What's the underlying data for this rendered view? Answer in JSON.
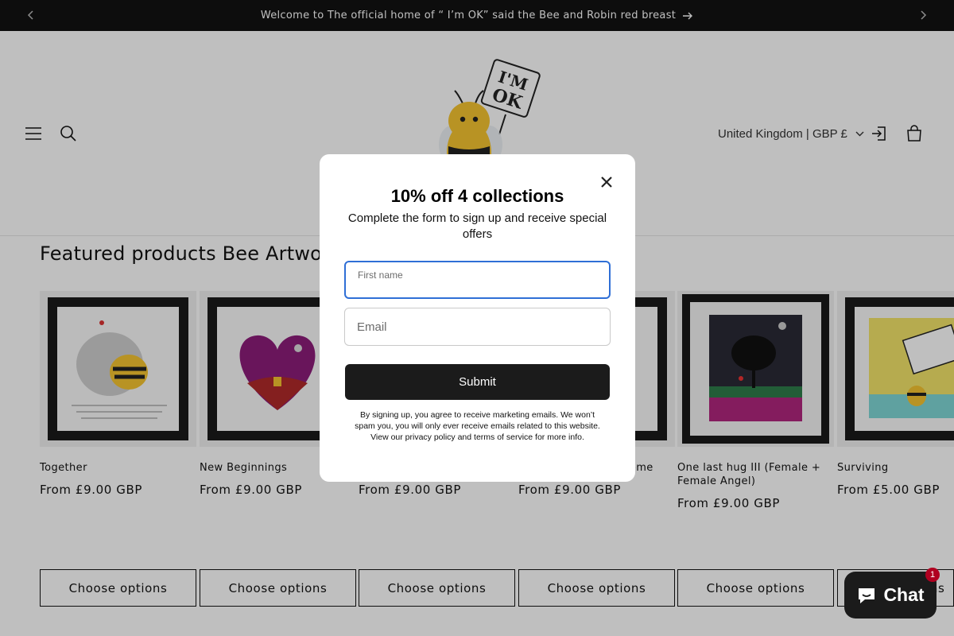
{
  "announcement": {
    "text": "Welcome to The official home of “ I’m OK” said the Bee and Robin red breast"
  },
  "header": {
    "logo_text": "I'M OK",
    "locale": "United Kingdom | GBP £"
  },
  "featured": {
    "title": "Featured products Bee Artworks",
    "button_label": "Choose options",
    "products": [
      {
        "title": "Together",
        "price": "From £9.00 GBP",
        "art": "together"
      },
      {
        "title": "New Beginnings",
        "price": "From £9.00 GBP",
        "art": "heart"
      },
      {
        "title": "",
        "price": "From £9.00 GBP",
        "art": "hidden"
      },
      {
        "title": "For how far you've come",
        "price": "From £9.00 GBP",
        "art": "hidden"
      },
      {
        "title": "One last hug III (Female + Female Angel)",
        "price": "From £9.00 GBP",
        "art": "tree"
      },
      {
        "title": "Surviving",
        "price": "From £5.00 GBP",
        "art": "surviving"
      }
    ]
  },
  "popup": {
    "title": "10% off 4 collections",
    "subtitle": "Complete the form to sign up and receive special offers",
    "first_name_label": "First name",
    "email_placeholder": "Email",
    "submit_label": "Submit",
    "legal": "By signing up, you agree to receive marketing emails. We won’t spam you, you will only ever receive emails related to this website. View our privacy policy and terms of service for more info."
  },
  "chat": {
    "label": "Chat",
    "badge": "1"
  },
  "colors": {
    "announcement_bg": "#121212",
    "focus_border": "#2f6fd6",
    "button_dark": "#1b1b1b",
    "badge": "#b00020"
  },
  "icons": [
    "chevron-left-icon",
    "chevron-right-icon",
    "arrow-right-icon",
    "menu-icon",
    "search-icon",
    "account-icon",
    "cart-icon",
    "close-icon",
    "chat-icon"
  ]
}
